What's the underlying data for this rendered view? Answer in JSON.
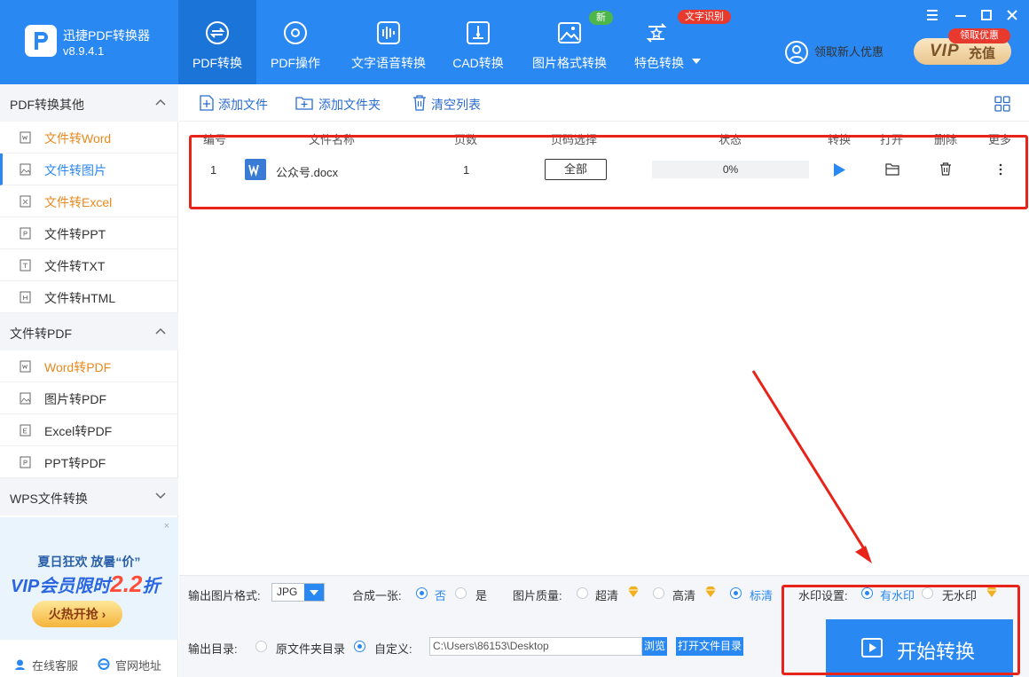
{
  "app": {
    "name": "迅捷PDF转换器",
    "version": "v8.9.4.1"
  },
  "nav": {
    "tabs": [
      {
        "label": "PDF转换"
      },
      {
        "label": "PDF操作"
      },
      {
        "label": "文字语音转换"
      },
      {
        "label": "CAD转换"
      },
      {
        "label": "图片格式转换",
        "badge": "新"
      },
      {
        "label": "特色转换",
        "badge": "文字识别"
      }
    ],
    "promo": "领取新人优惠",
    "vip_tag": "领取优惠",
    "vip_label": "VIP",
    "vip_action": "充值"
  },
  "sidebar": {
    "sections": [
      {
        "title": "PDF转换其他",
        "items": [
          "文件转Word",
          "文件转图片",
          "文件转Excel",
          "文件转PPT",
          "文件转TXT",
          "文件转HTML"
        ]
      },
      {
        "title": "文件转PDF",
        "items": [
          "Word转PDF",
          "图片转PDF",
          "Excel转PDF",
          "PPT转PDF"
        ]
      },
      {
        "title": "WPS文件转换",
        "items": []
      }
    ],
    "banner": {
      "line1": "夏日狂欢 放暑“价”",
      "line2_prefix": "VIP会员限时",
      "line2_num": "2.2",
      "line2_suffix": "折",
      "button": "火热开抢 ›",
      "close": "×"
    },
    "online_service": "在线客服",
    "website": "官网地址"
  },
  "toolbar": {
    "add_file": "添加文件",
    "add_folder": "添加文件夹",
    "clear_list": "清空列表"
  },
  "table": {
    "columns": [
      "编号",
      "文件名称",
      "页数",
      "页码选择",
      "状态",
      "转换",
      "打开",
      "删除",
      "更多"
    ],
    "rows": [
      {
        "index": "1",
        "name": "公众号.docx",
        "pages": "1",
        "range": "全部",
        "status": "0%"
      }
    ]
  },
  "settings": {
    "img_format_label": "输出图片格式:",
    "img_format_value": "JPG",
    "merge_label": "合成一张:",
    "merge_no": "否",
    "merge_yes": "是",
    "quality_label": "图片质量:",
    "quality_options": [
      "超清",
      "高清",
      "标清"
    ],
    "watermark_label": "水印设置:",
    "watermark_yes": "有水印",
    "watermark_no": "无水印",
    "output_label": "输出目录:",
    "output_original": "原文件夹目录",
    "output_custom": "自定义:",
    "output_path": "C:\\Users\\86153\\Desktop",
    "browse": "浏览",
    "open_folder": "打开文件目录",
    "start": "开始转换"
  },
  "colors": {
    "primary": "#2a88f2",
    "annotation_red": "#e8231a",
    "orange": "#e8891f"
  }
}
